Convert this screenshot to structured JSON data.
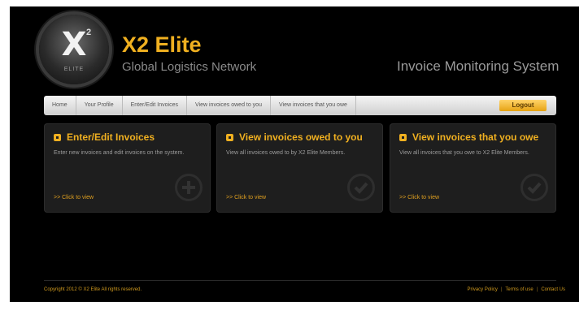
{
  "logo": {
    "mark": "X",
    "superscript": "2",
    "subtext": "ELITE"
  },
  "brand": {
    "title": "X2 Elite",
    "subtitle": "Global Logistics Network",
    "system_title": "Invoice Monitoring System"
  },
  "nav": {
    "items": [
      {
        "label": "Home"
      },
      {
        "label": "Your Profile"
      },
      {
        "label": "Enter/Edit Invoices"
      },
      {
        "label": "View invoices owed to you"
      },
      {
        "label": "View invoices that you owe"
      }
    ],
    "logout_label": "Logout"
  },
  "cards": [
    {
      "title": "Enter/Edit Invoices",
      "description": "Enter new invoices and edit invoices on the system.",
      "link": ">> Click to view",
      "icon": "plus-icon"
    },
    {
      "title": "View invoices owed to you",
      "description": "View all invoices owed to by X2 Elite Members.",
      "link": ">> Click to view",
      "icon": "check-icon"
    },
    {
      "title": "View invoices that you owe",
      "description": "View all invoices that you owe to X2 Elite Members.",
      "link": ">> Click to view",
      "icon": "check-icon"
    }
  ],
  "footer": {
    "copyright": "Copyright 2012 © X2 Elite All rights reserved.",
    "links": [
      "Privacy Policy",
      "Terms of use",
      "Contact Us"
    ],
    "separator": "|"
  },
  "colors": {
    "accent": "#f0b020",
    "background": "#000000",
    "card": "#1e1e1e",
    "nav": "#dcdcdc"
  }
}
